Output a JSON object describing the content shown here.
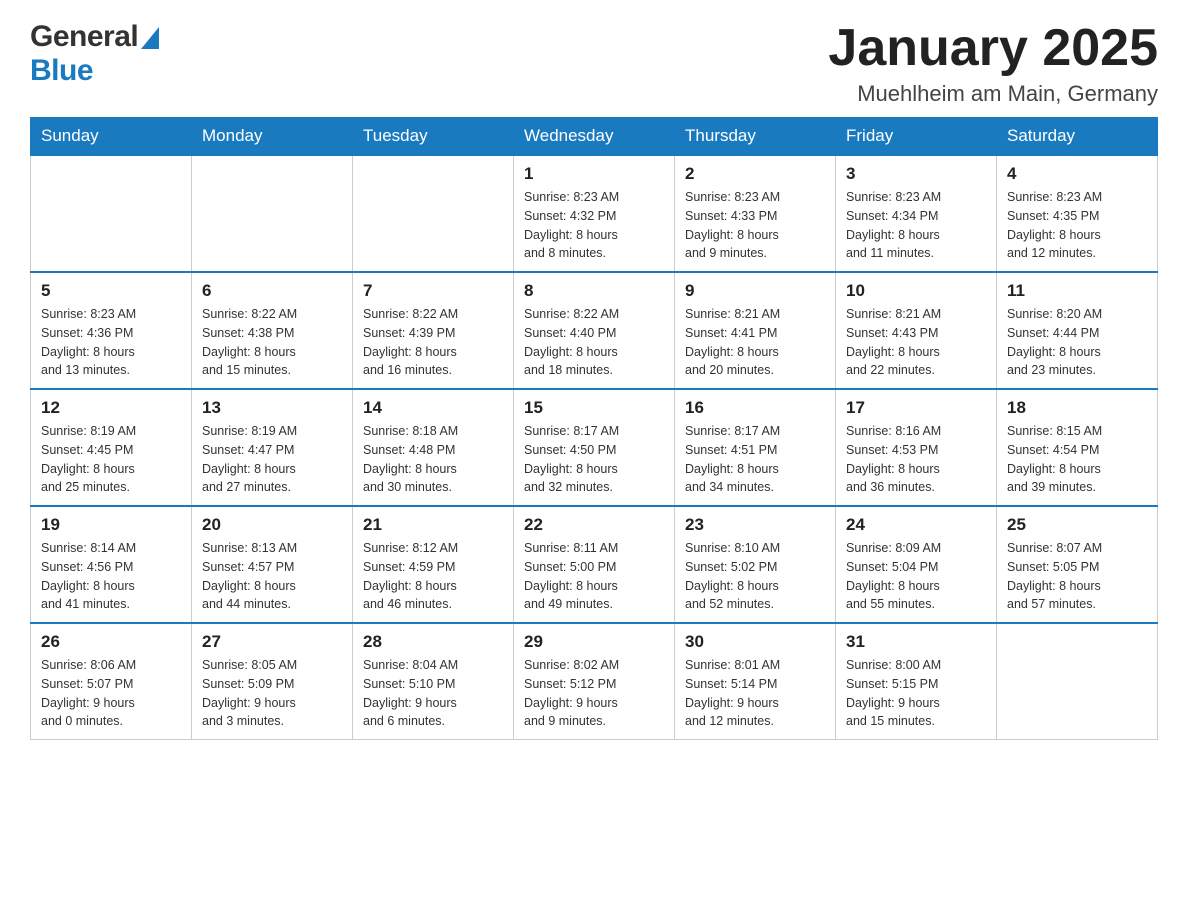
{
  "header": {
    "logo_general": "General",
    "logo_blue": "Blue",
    "month_title": "January 2025",
    "subtitle": "Muehlheim am Main, Germany"
  },
  "days_of_week": [
    "Sunday",
    "Monday",
    "Tuesday",
    "Wednesday",
    "Thursday",
    "Friday",
    "Saturday"
  ],
  "weeks": [
    {
      "days": [
        {
          "number": "",
          "info": ""
        },
        {
          "number": "",
          "info": ""
        },
        {
          "number": "",
          "info": ""
        },
        {
          "number": "1",
          "info": "Sunrise: 8:23 AM\nSunset: 4:32 PM\nDaylight: 8 hours\nand 8 minutes."
        },
        {
          "number": "2",
          "info": "Sunrise: 8:23 AM\nSunset: 4:33 PM\nDaylight: 8 hours\nand 9 minutes."
        },
        {
          "number": "3",
          "info": "Sunrise: 8:23 AM\nSunset: 4:34 PM\nDaylight: 8 hours\nand 11 minutes."
        },
        {
          "number": "4",
          "info": "Sunrise: 8:23 AM\nSunset: 4:35 PM\nDaylight: 8 hours\nand 12 minutes."
        }
      ]
    },
    {
      "days": [
        {
          "number": "5",
          "info": "Sunrise: 8:23 AM\nSunset: 4:36 PM\nDaylight: 8 hours\nand 13 minutes."
        },
        {
          "number": "6",
          "info": "Sunrise: 8:22 AM\nSunset: 4:38 PM\nDaylight: 8 hours\nand 15 minutes."
        },
        {
          "number": "7",
          "info": "Sunrise: 8:22 AM\nSunset: 4:39 PM\nDaylight: 8 hours\nand 16 minutes."
        },
        {
          "number": "8",
          "info": "Sunrise: 8:22 AM\nSunset: 4:40 PM\nDaylight: 8 hours\nand 18 minutes."
        },
        {
          "number": "9",
          "info": "Sunrise: 8:21 AM\nSunset: 4:41 PM\nDaylight: 8 hours\nand 20 minutes."
        },
        {
          "number": "10",
          "info": "Sunrise: 8:21 AM\nSunset: 4:43 PM\nDaylight: 8 hours\nand 22 minutes."
        },
        {
          "number": "11",
          "info": "Sunrise: 8:20 AM\nSunset: 4:44 PM\nDaylight: 8 hours\nand 23 minutes."
        }
      ]
    },
    {
      "days": [
        {
          "number": "12",
          "info": "Sunrise: 8:19 AM\nSunset: 4:45 PM\nDaylight: 8 hours\nand 25 minutes."
        },
        {
          "number": "13",
          "info": "Sunrise: 8:19 AM\nSunset: 4:47 PM\nDaylight: 8 hours\nand 27 minutes."
        },
        {
          "number": "14",
          "info": "Sunrise: 8:18 AM\nSunset: 4:48 PM\nDaylight: 8 hours\nand 30 minutes."
        },
        {
          "number": "15",
          "info": "Sunrise: 8:17 AM\nSunset: 4:50 PM\nDaylight: 8 hours\nand 32 minutes."
        },
        {
          "number": "16",
          "info": "Sunrise: 8:17 AM\nSunset: 4:51 PM\nDaylight: 8 hours\nand 34 minutes."
        },
        {
          "number": "17",
          "info": "Sunrise: 8:16 AM\nSunset: 4:53 PM\nDaylight: 8 hours\nand 36 minutes."
        },
        {
          "number": "18",
          "info": "Sunrise: 8:15 AM\nSunset: 4:54 PM\nDaylight: 8 hours\nand 39 minutes."
        }
      ]
    },
    {
      "days": [
        {
          "number": "19",
          "info": "Sunrise: 8:14 AM\nSunset: 4:56 PM\nDaylight: 8 hours\nand 41 minutes."
        },
        {
          "number": "20",
          "info": "Sunrise: 8:13 AM\nSunset: 4:57 PM\nDaylight: 8 hours\nand 44 minutes."
        },
        {
          "number": "21",
          "info": "Sunrise: 8:12 AM\nSunset: 4:59 PM\nDaylight: 8 hours\nand 46 minutes."
        },
        {
          "number": "22",
          "info": "Sunrise: 8:11 AM\nSunset: 5:00 PM\nDaylight: 8 hours\nand 49 minutes."
        },
        {
          "number": "23",
          "info": "Sunrise: 8:10 AM\nSunset: 5:02 PM\nDaylight: 8 hours\nand 52 minutes."
        },
        {
          "number": "24",
          "info": "Sunrise: 8:09 AM\nSunset: 5:04 PM\nDaylight: 8 hours\nand 55 minutes."
        },
        {
          "number": "25",
          "info": "Sunrise: 8:07 AM\nSunset: 5:05 PM\nDaylight: 8 hours\nand 57 minutes."
        }
      ]
    },
    {
      "days": [
        {
          "number": "26",
          "info": "Sunrise: 8:06 AM\nSunset: 5:07 PM\nDaylight: 9 hours\nand 0 minutes."
        },
        {
          "number": "27",
          "info": "Sunrise: 8:05 AM\nSunset: 5:09 PM\nDaylight: 9 hours\nand 3 minutes."
        },
        {
          "number": "28",
          "info": "Sunrise: 8:04 AM\nSunset: 5:10 PM\nDaylight: 9 hours\nand 6 minutes."
        },
        {
          "number": "29",
          "info": "Sunrise: 8:02 AM\nSunset: 5:12 PM\nDaylight: 9 hours\nand 9 minutes."
        },
        {
          "number": "30",
          "info": "Sunrise: 8:01 AM\nSunset: 5:14 PM\nDaylight: 9 hours\nand 12 minutes."
        },
        {
          "number": "31",
          "info": "Sunrise: 8:00 AM\nSunset: 5:15 PM\nDaylight: 9 hours\nand 15 minutes."
        },
        {
          "number": "",
          "info": ""
        }
      ]
    }
  ]
}
